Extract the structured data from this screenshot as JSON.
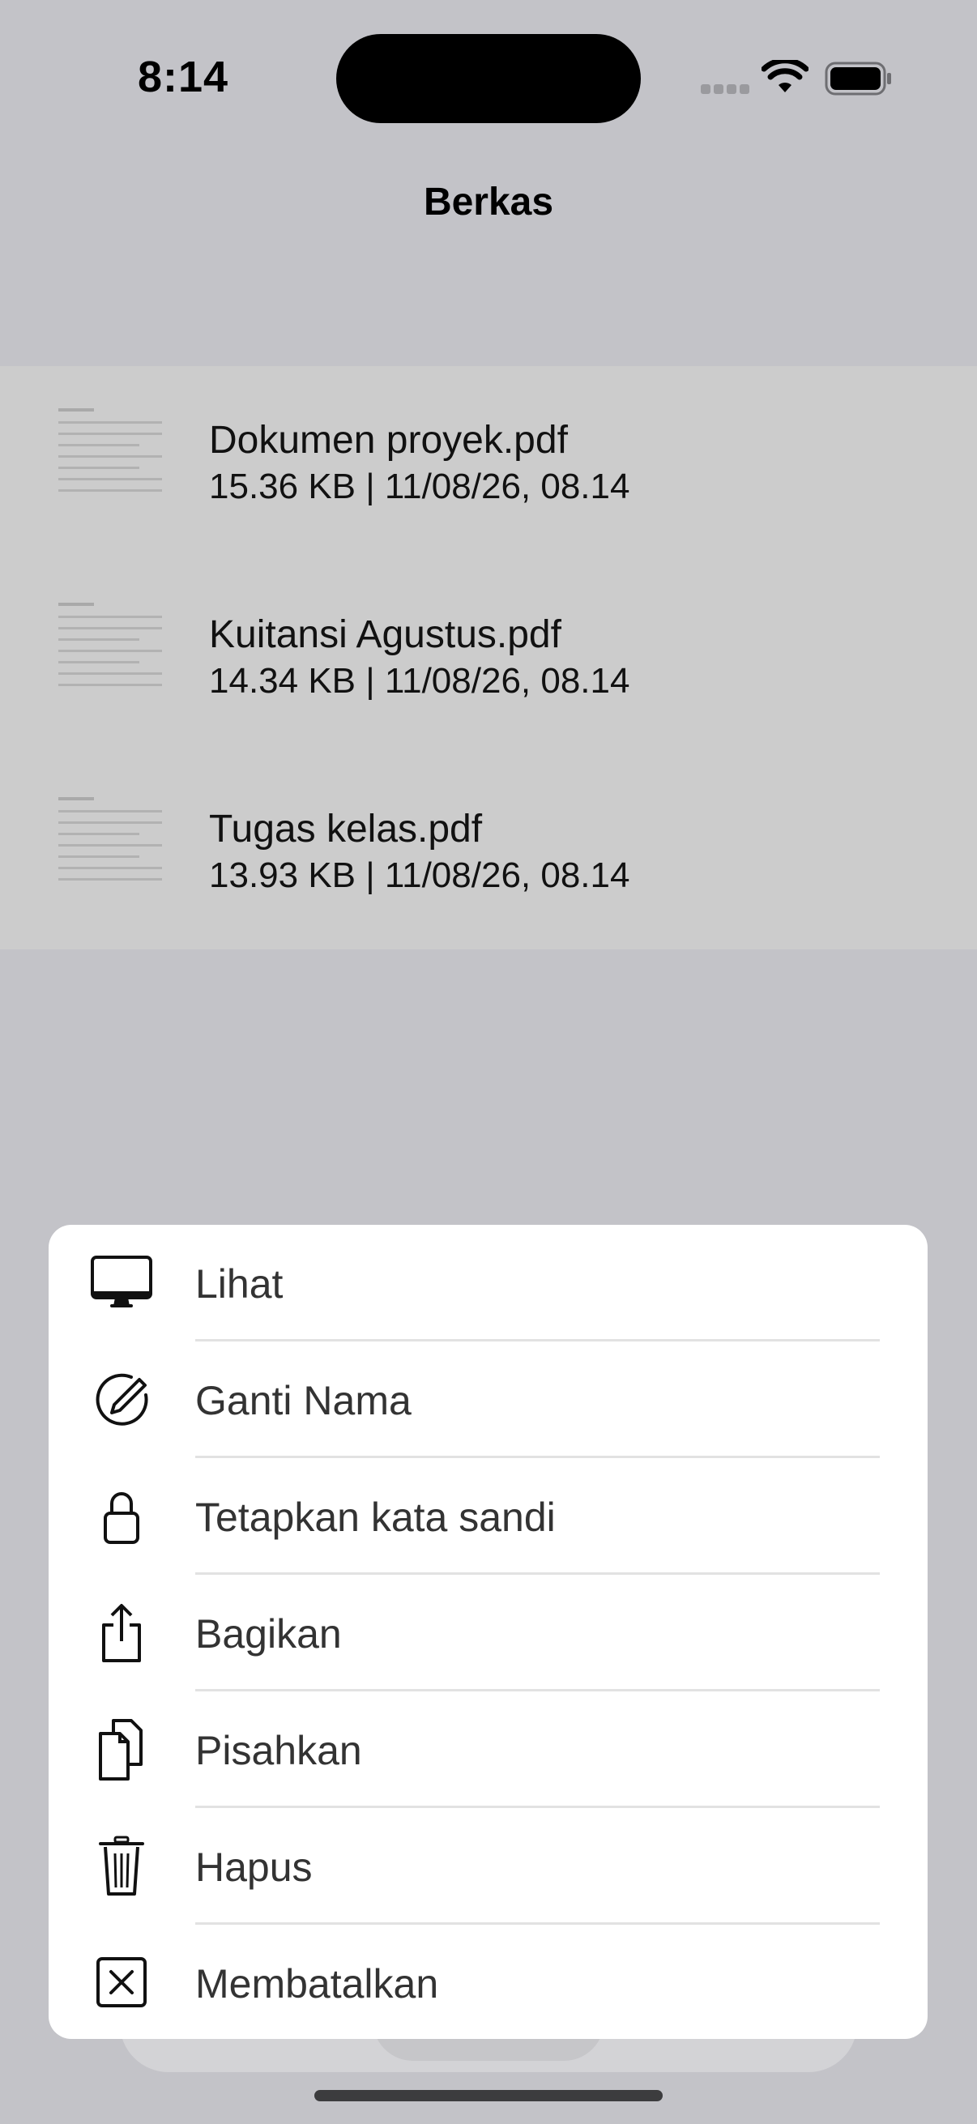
{
  "status_bar": {
    "time": "8:14"
  },
  "nav": {
    "title": "Berkas"
  },
  "files": [
    {
      "name": "Dokumen proyek.pdf",
      "meta": "15.36 KB | 11/08/26, 08.14"
    },
    {
      "name": "Kuitansi Agustus.pdf",
      "meta": "14.34 KB | 11/08/26, 08.14"
    },
    {
      "name": "Tugas kelas.pdf",
      "meta": "13.93 KB | 11/08/26, 08.14"
    }
  ],
  "action_sheet": {
    "items": [
      {
        "label": "Lihat",
        "icon": "display-icon"
      },
      {
        "label": "Ganti Nama",
        "icon": "rename-pencil-icon"
      },
      {
        "label": "Tetapkan kata sandi",
        "icon": "lock-icon"
      },
      {
        "label": "Bagikan",
        "icon": "share-icon"
      },
      {
        "label": "Pisahkan",
        "icon": "split-documents-icon"
      },
      {
        "label": "Hapus",
        "icon": "trash-icon"
      },
      {
        "label": "Membatalkan",
        "icon": "cancel-x-icon"
      }
    ]
  },
  "colors": {
    "background": "#c3c3c8",
    "list_background": "#cccccc",
    "sheet_background": "#ffffff"
  }
}
